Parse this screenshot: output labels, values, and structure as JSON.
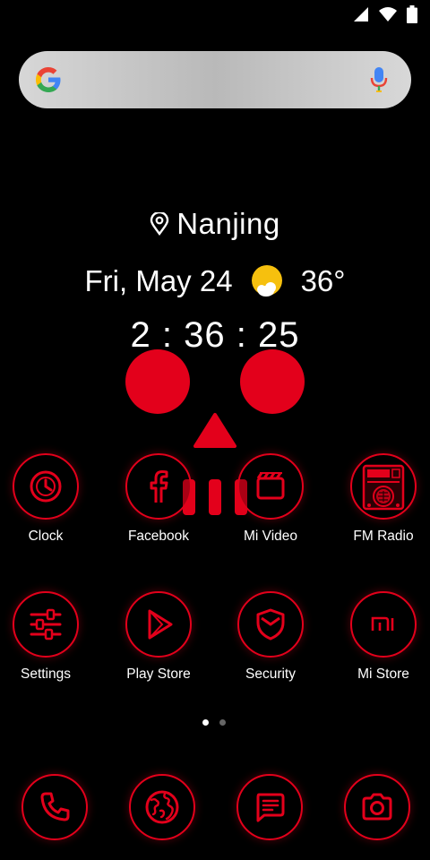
{
  "status_bar": {
    "icons": [
      "signal-icon",
      "wifi-icon",
      "battery-icon"
    ]
  },
  "search": {
    "logo": "google-g-icon",
    "mic": "mic-icon"
  },
  "widget": {
    "city": "Nanjing",
    "date": "Fri, May 24",
    "temperature": "36°",
    "weather_icon": "sunny-cloud-icon",
    "time": "2 : 36 : 25"
  },
  "apps": [
    {
      "label": "Clock",
      "icon": "clock-icon"
    },
    {
      "label": "Facebook",
      "icon": "facebook-icon"
    },
    {
      "label": "Mi Video",
      "icon": "clapperboard-icon"
    },
    {
      "label": "FM Radio",
      "icon": "radio-icon"
    },
    {
      "label": "Settings",
      "icon": "sliders-icon"
    },
    {
      "label": "Play Store",
      "icon": "play-icon"
    },
    {
      "label": "Security",
      "icon": "shield-icon"
    },
    {
      "label": "Mi Store",
      "icon": "mi-logo-icon"
    }
  ],
  "pager": {
    "pages": 2,
    "current": 1
  },
  "dock": [
    {
      "icon": "phone-icon"
    },
    {
      "icon": "globe-icon"
    },
    {
      "icon": "message-icon"
    },
    {
      "icon": "camera-icon"
    }
  ],
  "colors": {
    "accent": "#e3001b",
    "background": "#000000",
    "text": "#ffffff"
  }
}
